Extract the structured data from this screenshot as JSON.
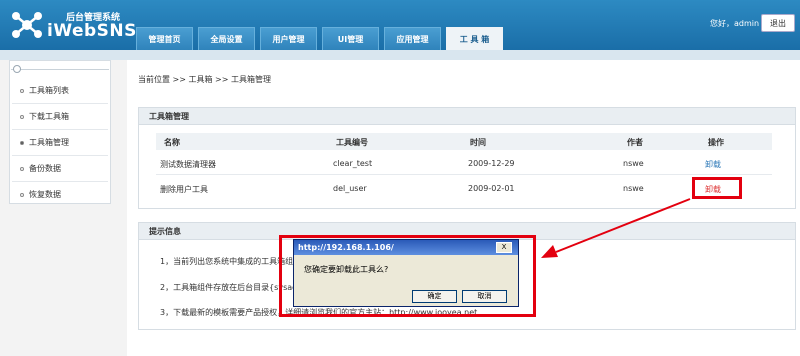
{
  "header": {
    "logo_subtitle": "后台管理系统",
    "logo_text": "iWebSNS",
    "greeting": "您好，admin",
    "logout": "退出"
  },
  "nav": {
    "tabs": [
      {
        "label": "管理首页"
      },
      {
        "label": "全局设置"
      },
      {
        "label": "用户管理"
      },
      {
        "label": "UI管理"
      },
      {
        "label": "应用管理"
      },
      {
        "label": "工 具 箱",
        "active": true
      }
    ]
  },
  "sidebar": {
    "items": [
      {
        "label": "工具箱列表"
      },
      {
        "label": "下载工具箱"
      },
      {
        "label": "工具箱管理",
        "active": true
      },
      {
        "label": "备份数据"
      },
      {
        "label": "恢复数据"
      }
    ]
  },
  "breadcrumb": "当前位置 >> 工具箱 >> 工具箱管理",
  "manage_panel": {
    "title": "工具箱管理",
    "columns": [
      "名称",
      "工具编号",
      "时间",
      "作者",
      "操作"
    ],
    "rows": [
      {
        "name": "测试数据清理器",
        "id": "clear_test",
        "time": "2009-12-29",
        "author": "nswe",
        "action": "卸载"
      },
      {
        "name": "删除用户工具",
        "id": "del_user",
        "time": "2009-02-01",
        "author": "nswe",
        "action": "卸载"
      }
    ]
  },
  "tips_panel": {
    "title": "提示信息",
    "lines": [
      "1，当前列出您系统中集成的工具箱组件",
      "2，工具箱组件存放在后台目录{sysadm",
      "3，下载最新的模板需要产品授权，详细请浏览我们的官方主站：http://www.jooyea.net"
    ]
  },
  "dialog": {
    "title": "http://192.168.1.106/",
    "close": "X",
    "message": "您确定要卸载此工具么?",
    "ok": "确定",
    "cancel": "取消"
  },
  "colors": {
    "header_blue": "#1a6ea8",
    "annotation_red": "#e3000f",
    "link_blue": "#2d79b8",
    "link_red": "#d33"
  }
}
